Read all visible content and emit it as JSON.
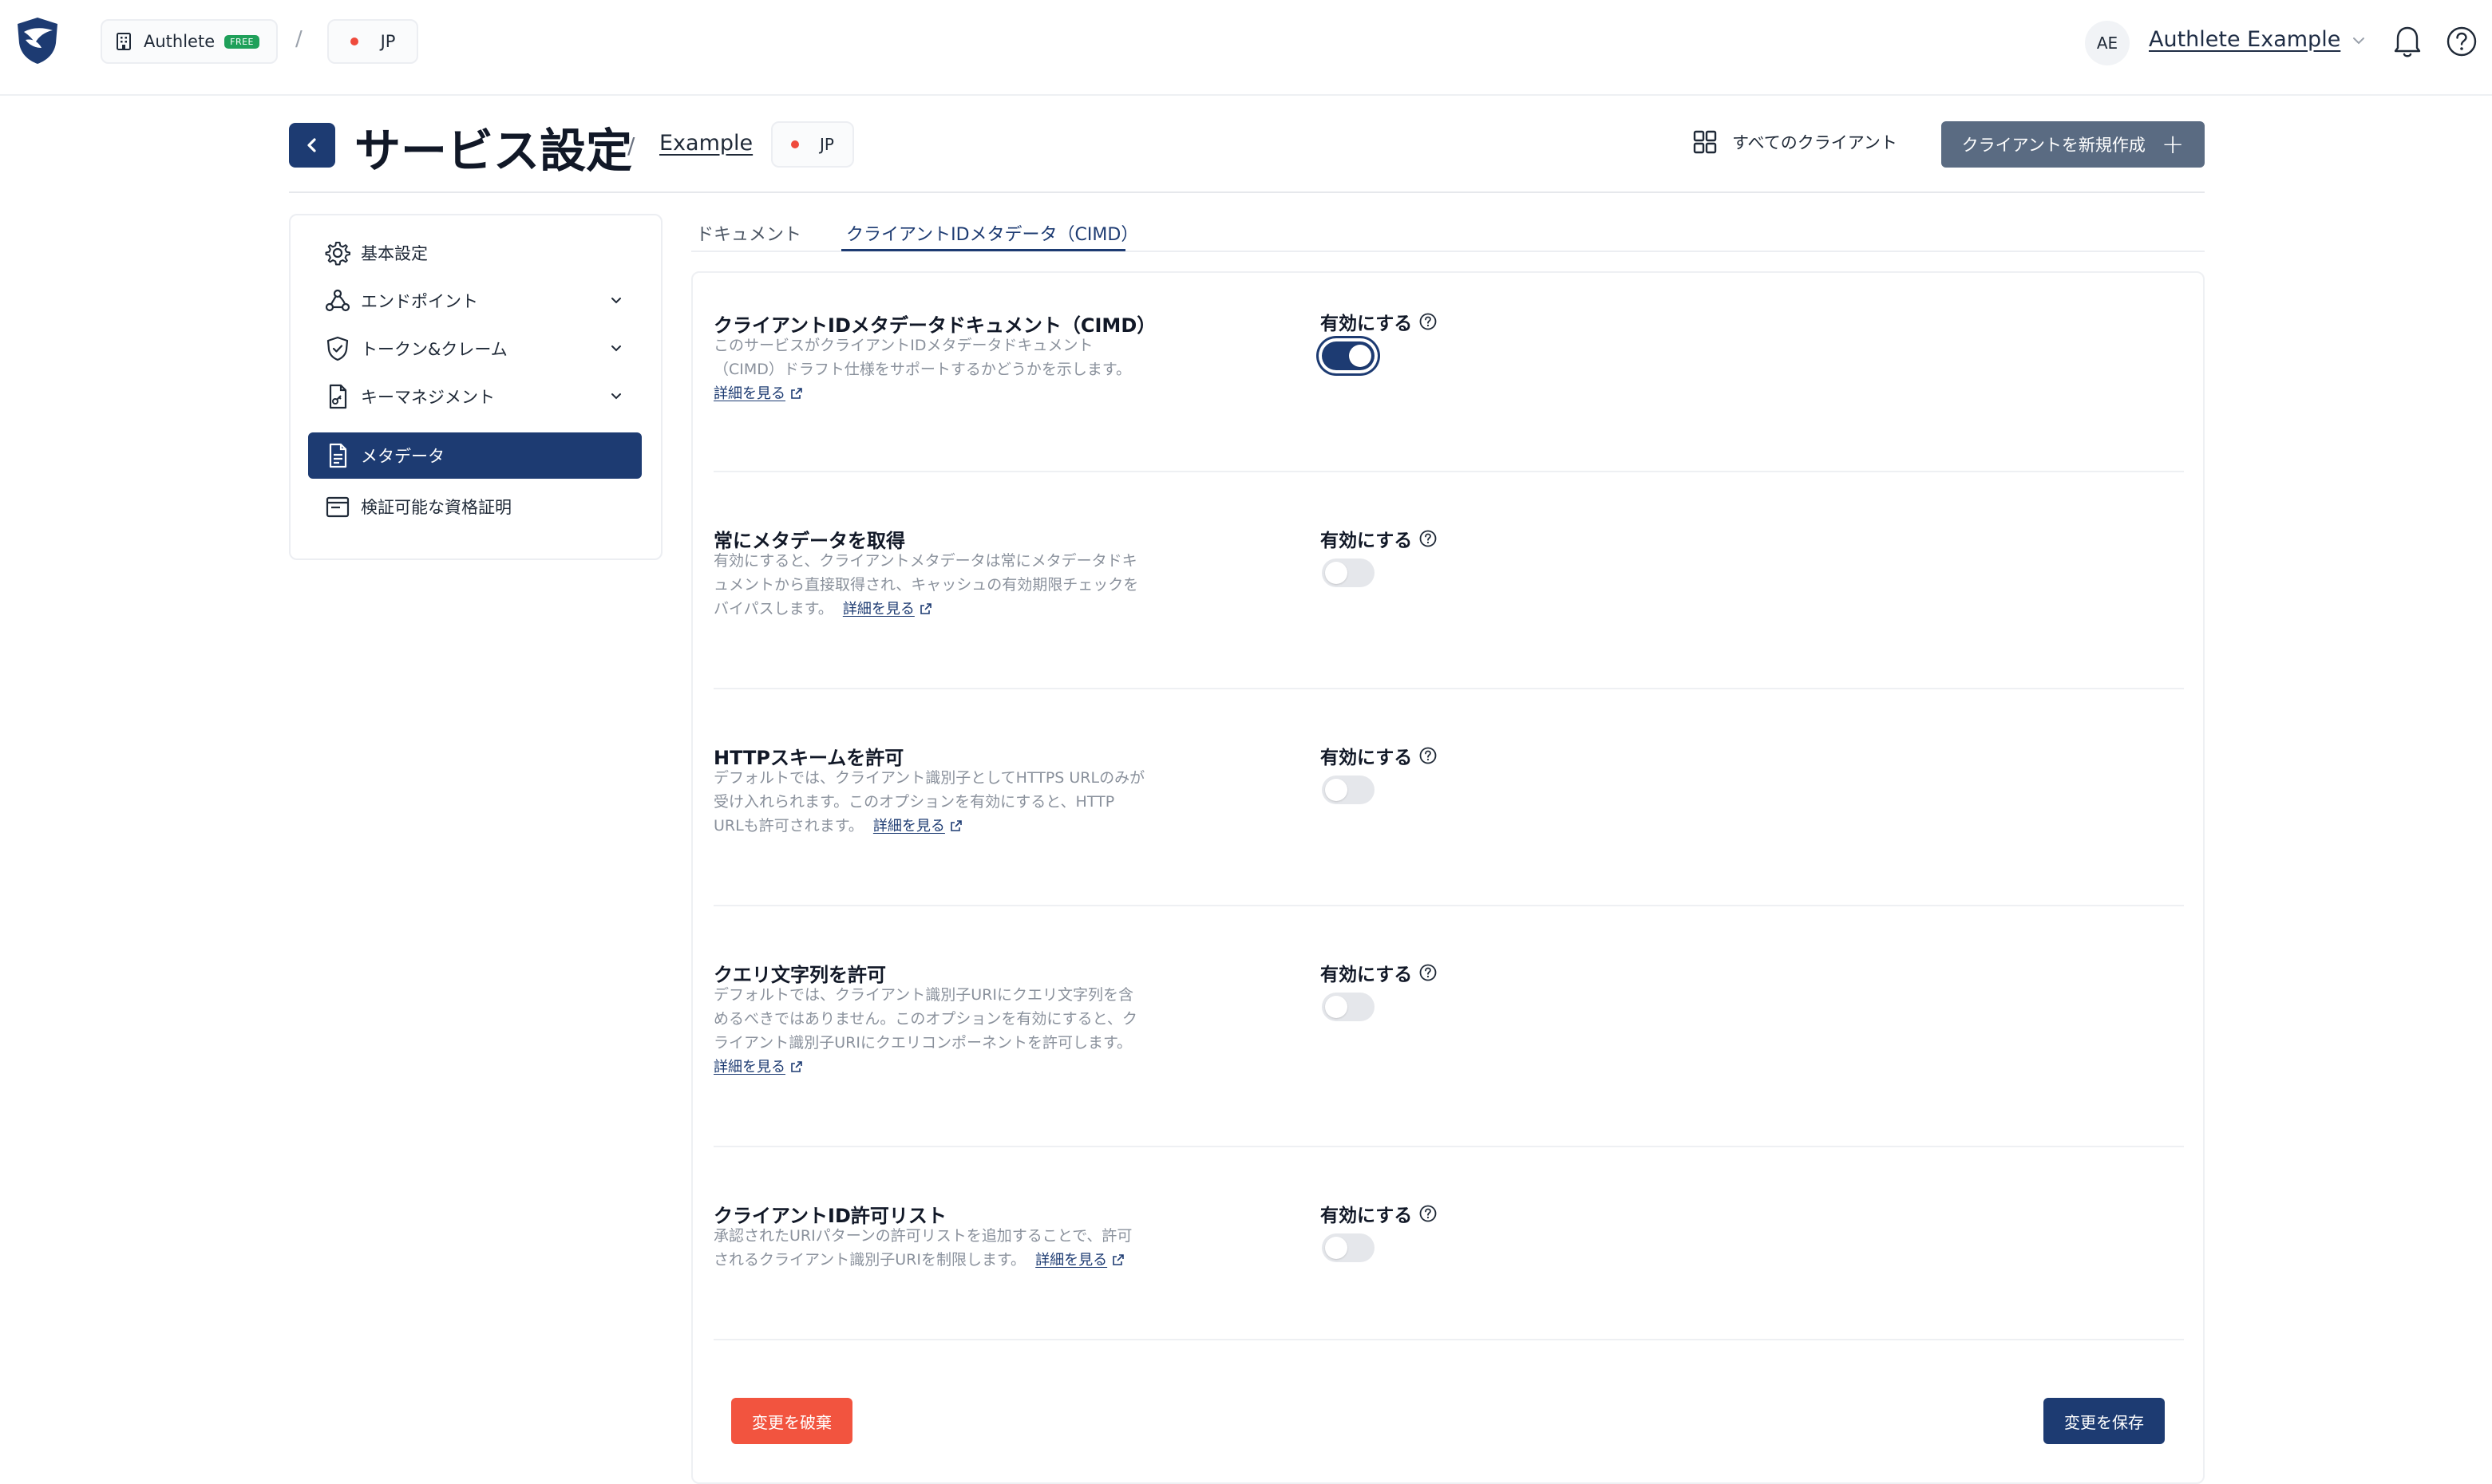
{
  "header": {
    "org_name": "Authlete",
    "org_badge": "FREE",
    "crumb_separator": "/",
    "env_label": "JP",
    "avatar_initials": "AE",
    "account_name": "Authlete Example"
  },
  "page": {
    "title": "サービス設定",
    "title_separator": "/",
    "service_name": "Example",
    "env_label": "JP",
    "all_clients_label": "すべてのクライアント",
    "new_client_label": "クライアントを新規作成"
  },
  "sidebar": {
    "items": [
      {
        "label": "基本設定",
        "icon": "gear-icon"
      },
      {
        "label": "エンドポイント",
        "icon": "webhook-icon",
        "expandable": true
      },
      {
        "label": "トークン&クレーム",
        "icon": "shield-check-icon",
        "expandable": true
      },
      {
        "label": "キーマネジメント",
        "icon": "key-file-icon",
        "expandable": true
      },
      {
        "label": "メタデータ",
        "icon": "document-icon",
        "active": true
      },
      {
        "label": "検証可能な資格証明",
        "icon": "credential-icon"
      }
    ]
  },
  "tabs": [
    {
      "label": "ドキュメント"
    },
    {
      "label": "クライアントIDメタデータ（CIMD）",
      "active": true
    }
  ],
  "settings": [
    {
      "title": "クライアントIDメタデータドキュメント（CIMD）",
      "desc_lines": [
        "このサービスがクライアントIDメタデータドキュメント",
        "（CIMD）ドラフト仕様をサポートするかどうかを示します。"
      ],
      "more": "詳細を見る",
      "enable_label": "有効にする",
      "enabled": true
    },
    {
      "title": "常にメタデータを取得",
      "desc_lines": [
        "有効にすると、クライアントメタデータは常にメタデータドキ",
        "ュメントから直接取得され、キャッシュの有効期限チェックを",
        "バイパスします。"
      ],
      "more": "詳細を見る",
      "enable_label": "有効にする",
      "enabled": false
    },
    {
      "title": "HTTPスキームを許可",
      "desc_lines": [
        "デフォルトでは、クライアント識別子としてHTTPS URLのみが",
        "受け入れられます。このオプションを有効にすると、HTTP",
        "URLも許可されます。"
      ],
      "more": "詳細を見る",
      "enable_label": "有効にする",
      "enabled": false
    },
    {
      "title": "クエリ文字列を許可",
      "desc_lines": [
        "デフォルトでは、クライアント識別子URIにクエリ文字列を含",
        "めるべきではありません。このオプションを有効にすると、ク",
        "ライアント識別子URIにクエリコンポーネントを許可します。"
      ],
      "more": "詳細を見る",
      "enable_label": "有効にする",
      "enabled": false
    },
    {
      "title": "クライアントID許可リスト",
      "desc_lines": [
        "承認されたURIパターンの許可リストを追加することで、許可",
        "されるクライアント識別子URIを制限します。"
      ],
      "more": "詳細を見る",
      "enable_label": "有効にする",
      "enabled": false
    }
  ],
  "actions": {
    "discard_label": "変更を破棄",
    "save_label": "変更を保存"
  },
  "colors": {
    "primary": "#1d3b72",
    "danger": "#f2543f",
    "secondary_button": "#5a6b82",
    "free_badge": "#1fa05a",
    "env_dot": "#ef4a3c"
  }
}
